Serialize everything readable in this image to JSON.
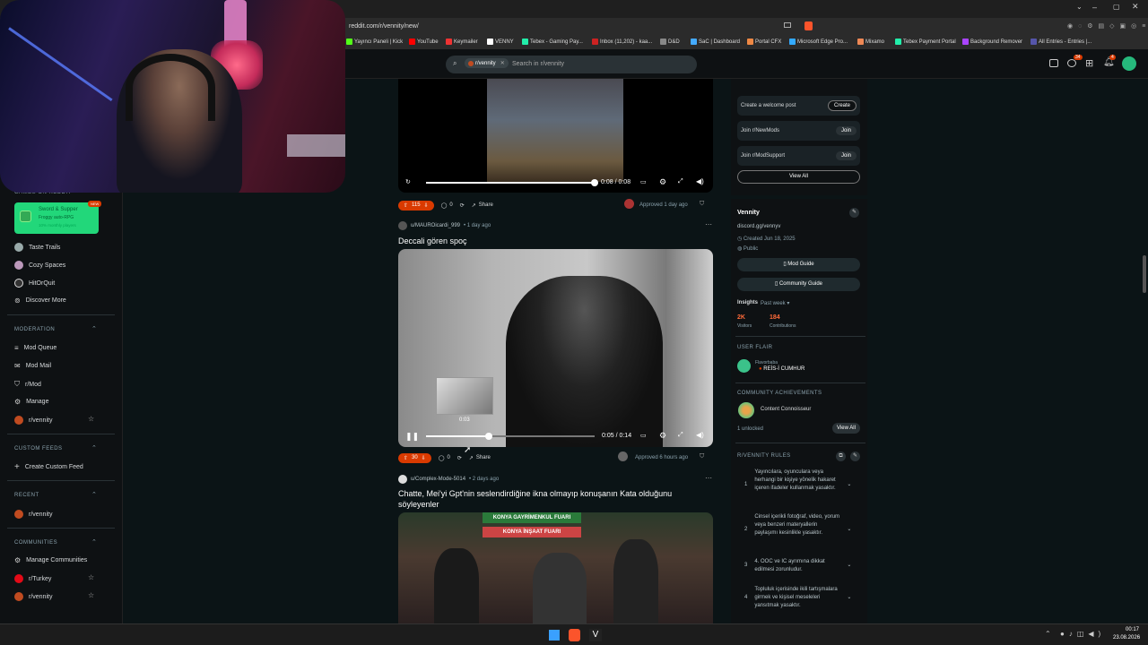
{
  "browser": {
    "url": "reddit.com/r/vennity/new/",
    "bookmarks": [
      "Yayıncı Paneli | Kick",
      "YouTube",
      "Keymailer",
      "VENNY",
      "Tebex - Gaming Pay...",
      "Inbox (11,202) - kaa...",
      "D&D",
      "SaC | Dashboard",
      "Portal CFX",
      "Microsoft Edge Pro...",
      "Mixamo",
      "Tebex Payment Portal",
      "Background Remover",
      "All Entries - Entries |..."
    ],
    "bookmark_colors": [
      "#53fc18",
      "#ff0000",
      "#e33",
      "#fff",
      "#2ea",
      "#c22",
      "#888",
      "#4af",
      "#e84",
      "#3af",
      "#e85",
      "#2ea",
      "#a4f",
      "#55a"
    ]
  },
  "header": {
    "community_chip": "r/vennity",
    "search_placeholder": "Search in r/vennity",
    "notif_badge_1": "34",
    "notif_badge_2": "4"
  },
  "sidebar": {
    "games_heading": "GAMES ON REDDIT",
    "promo": {
      "title": "Sword & Supper",
      "subtitle": "Froggy auto-RPG",
      "meta": "10% monthly players",
      "badge": "NEW"
    },
    "games": [
      "Taste Trails",
      "Cozy Spaces",
      "HitOrQuit",
      "Discover More"
    ],
    "moderation_heading": "MODERATION",
    "moderation": [
      "Mod Queue",
      "Mod Mail",
      "r/Mod",
      "Manage",
      "r/vennity"
    ],
    "custom_feeds_heading": "CUSTOM FEEDS",
    "custom_feeds": [
      "Create Custom Feed"
    ],
    "recent_heading": "RECENT",
    "recent": [
      "r/vennity"
    ],
    "communities_heading": "COMMUNITIES",
    "communities": [
      "Manage Communities",
      "r/Turkey",
      "r/vennity"
    ]
  },
  "posts": [
    {
      "time": "0:08 / 0:08",
      "progress": 1.0,
      "votes": "115",
      "comments": "0",
      "share": "Share",
      "approved": "Approved 1 day ago"
    },
    {
      "author": "u/MAUROicardi_999",
      "age": "• 1 day ago",
      "title": "Deccali gören spoç",
      "time": "0:05 / 0:14",
      "progress": 0.37,
      "hover_time": "0:03",
      "votes": "30",
      "comments": "0",
      "share": "Share",
      "approved": "Approved 6 hours ago"
    },
    {
      "author": "u/Complex-Mode-5014",
      "age": "• 2 days ago",
      "title": "Chatte, Mei'yi Gpt'nin seslendirdiğine ikna olmayıp konuşanın Kata olduğunu söyleyenler",
      "banner_top": "KONYA GAYRİMENKUL FUARI",
      "banner_bottom": "KONYA İNŞAAT FUARI"
    }
  ],
  "right": {
    "welcome": {
      "label": "Create a welcome post",
      "button": "Create"
    },
    "join1": {
      "label": "Join r/NewMods",
      "button": "Join"
    },
    "join2": {
      "label": "Join r/ModSupport",
      "button": "Join"
    },
    "view_all": "View All",
    "community_name": "Vennity",
    "community_desc": "discord.gg/vennyv",
    "created": "Created Jun 18, 2025",
    "visibility": "Public",
    "mod_guide": "Mod Guide",
    "community_guide": "Community Guide",
    "insights": "Insights",
    "insights_period": "Past week ▾",
    "visitors_value": "2K",
    "visitors_label": "Visitors",
    "contrib_value": "184",
    "contrib_label": "Contributions",
    "user_flair_heading": "USER FLAIR",
    "flair_user": "Flavorbaba",
    "flair_text": "REİS-İ CUMHUR",
    "achievements_heading": "COMMUNITY ACHIEVEMENTS",
    "achievement": "Content Connoisseur",
    "unlocked": "1 unlocked",
    "achievements_view_all": "View All",
    "rules_heading": "R/VENNITY RULES",
    "rules": [
      {
        "n": "1",
        "text": "Yayıncılara, oyunculara veya herhangi bir kişiye yönelik hakaret içeren ifadeler kullanmak yasaktır."
      },
      {
        "n": "2",
        "text": "Cinsel içerikli fotoğraf, video, yorum veya benzeri materyallerin paylaşımı kesinlikle yasaktır."
      },
      {
        "n": "3",
        "text": "4. OOC ve IC ayrımına dikkat edilmesi zorunludur."
      },
      {
        "n": "4",
        "text": "Topluluk içerisinde ikili tartışmalara girmek ve kişisel meseleleri yansıtmak yasaktır."
      }
    ]
  },
  "taskbar": {
    "time": "00:17",
    "date": "23.08.2026"
  }
}
